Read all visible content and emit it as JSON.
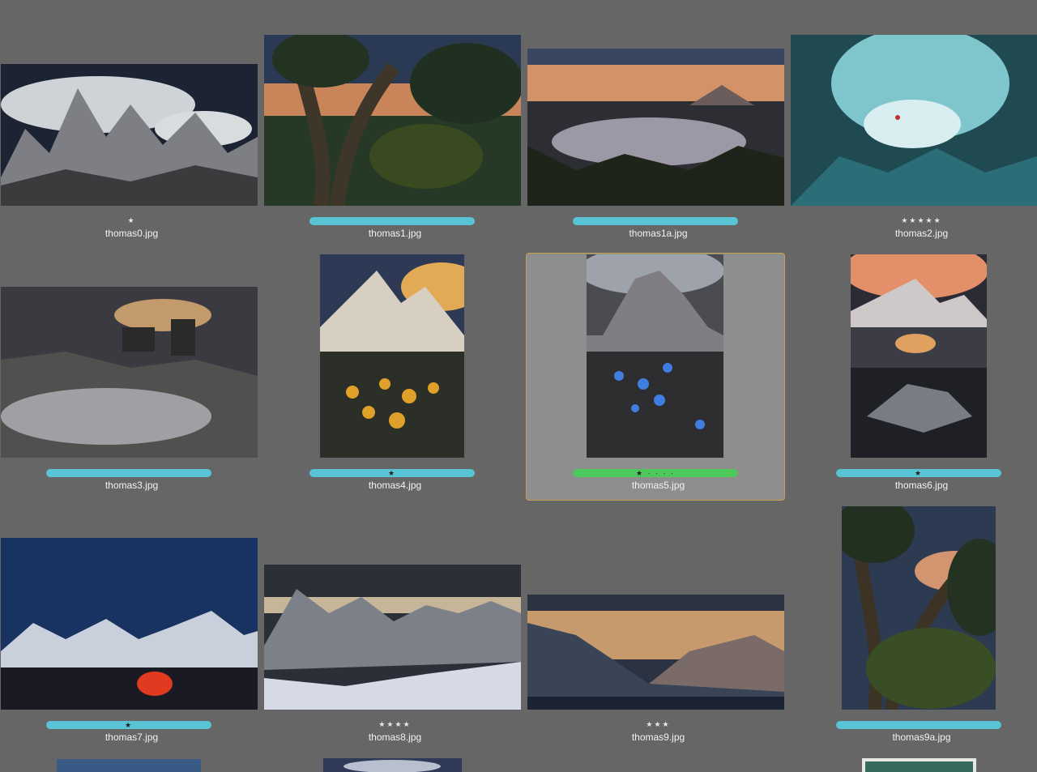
{
  "grid": {
    "items": [
      {
        "file": "thomas0.jpg",
        "stars": "★",
        "label_color": null
      },
      {
        "file": "thomas1.jpg",
        "stars": "",
        "label_color": "#58c4d6"
      },
      {
        "file": "thomas1a.jpg",
        "stars": "",
        "label_color": "#58c4d6"
      },
      {
        "file": "thomas2.jpg",
        "stars": "★★★★★",
        "label_color": null
      },
      {
        "file": "thomas3.jpg",
        "stars": "",
        "label_color": "#58c4d6"
      },
      {
        "file": "thomas4.jpg",
        "stars": "★",
        "label_color": "#58c4d6"
      },
      {
        "file": "thomas5.jpg",
        "stars": "★ · · · ·",
        "label_color": "#4cc95a",
        "selected": true
      },
      {
        "file": "thomas6.jpg",
        "stars": "★",
        "label_color": "#58c4d6"
      },
      {
        "file": "thomas7.jpg",
        "stars": "★",
        "label_color": "#58c4d6"
      },
      {
        "file": "thomas8.jpg",
        "stars": "★★★★",
        "label_color": null
      },
      {
        "file": "thomas9.jpg",
        "stars": "★★★",
        "label_color": null
      },
      {
        "file": "thomas9a.jpg",
        "stars": "",
        "label_color": "#58c4d6"
      }
    ]
  },
  "colors": {
    "background": "#666666",
    "selection_border": "#c4a24a",
    "selection_fill": "#8e8e8e"
  }
}
